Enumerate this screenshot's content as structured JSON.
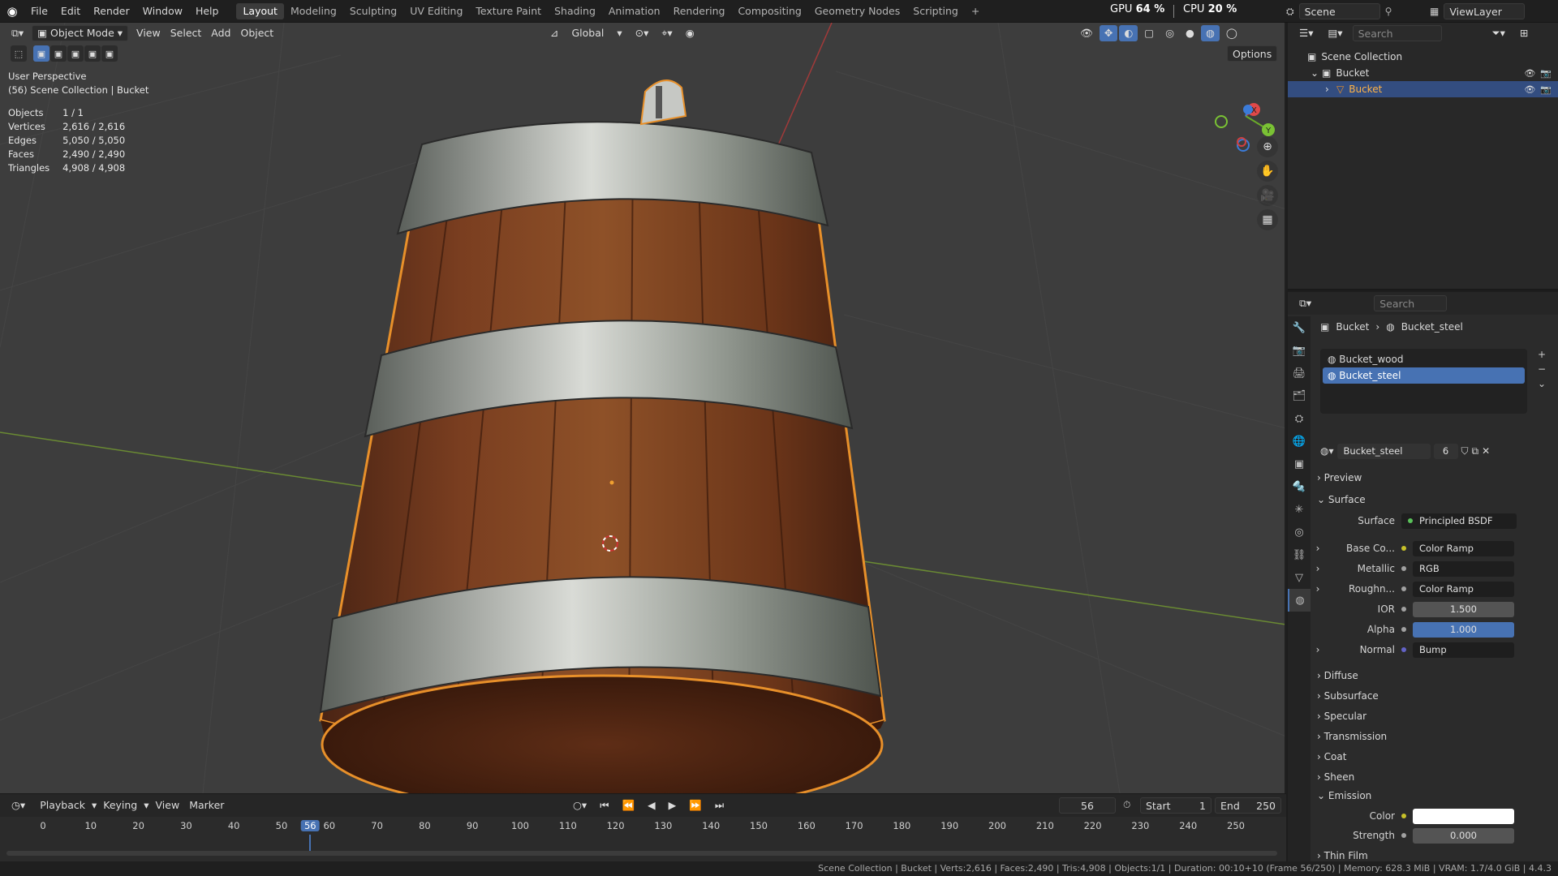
{
  "topbar": {
    "menus": [
      "File",
      "Edit",
      "Render",
      "Window",
      "Help"
    ],
    "workspaces": [
      "Layout",
      "Modeling",
      "Sculpting",
      "UV Editing",
      "Texture Paint",
      "Shading",
      "Animation",
      "Rendering",
      "Compositing",
      "Geometry Nodes",
      "Scripting"
    ],
    "active_workspace": "Layout",
    "add_tab": "+",
    "gpu_label": "GPU",
    "gpu_value": "64 %",
    "cpu_label": "CPU",
    "cpu_value": "20 %",
    "scene": "Scene",
    "view_layer": "ViewLayer"
  },
  "viewport": {
    "mode": "Object Mode",
    "menus": [
      "View",
      "Select",
      "Add",
      "Object"
    ],
    "orientation": "Global",
    "options": "Options",
    "perspective": "User Perspective",
    "collection": "(56) Scene Collection | Bucket",
    "stats": [
      {
        "label": "Objects",
        "value": "1 / 1"
      },
      {
        "label": "Vertices",
        "value": "2,616 / 2,616"
      },
      {
        "label": "Edges",
        "value": "5,050 / 5,050"
      },
      {
        "label": "Faces",
        "value": "2,490 / 2,490"
      },
      {
        "label": "Triangles",
        "value": "4,908 / 4,908"
      }
    ],
    "gizmo": {
      "x": "X",
      "y": "Y",
      "z": "Z"
    }
  },
  "timeline": {
    "menus": [
      "Playback",
      "Keying",
      "View",
      "Marker"
    ],
    "current_frame": "56",
    "start_label": "Start",
    "start": "1",
    "end_label": "End",
    "end": "250",
    "ticks": [
      "0",
      "10",
      "20",
      "30",
      "40",
      "50",
      "56",
      "60",
      "70",
      "80",
      "90",
      "100",
      "110",
      "120",
      "130",
      "140",
      "150",
      "160",
      "170",
      "180",
      "190",
      "200",
      "210",
      "220",
      "230",
      "240",
      "250"
    ]
  },
  "statusbar": "Scene Collection | Bucket | Verts:2,616 | Faces:2,490 | Tris:4,908 | Objects:1/1 | Duration: 00:10+10 (Frame 56/250) | Memory: 628.3 MiB | VRAM: 1.7/4.0 GiB | 4.4.3",
  "outliner": {
    "search_placeholder": "Search",
    "rows": [
      {
        "label": "Scene Collection",
        "indent": 0
      },
      {
        "label": "Bucket",
        "indent": 1
      },
      {
        "label": "Bucket",
        "indent": 2,
        "selected": true
      }
    ]
  },
  "properties": {
    "search_placeholder": "Search",
    "breadcrumb_object": "Bucket",
    "breadcrumb_material": "Bucket_steel",
    "slots": [
      {
        "name": "Bucket_wood",
        "selected": false
      },
      {
        "name": "Bucket_steel",
        "selected": true
      }
    ],
    "material_name": "Bucket_steel",
    "user_count": "6",
    "preview": "Preview",
    "surface_section": "Surface",
    "surface_label": "Surface",
    "surface_value": "Principled BSDF",
    "fields": [
      {
        "label": "Base Co...",
        "value": "Color Ramp",
        "dot": "#c7c129",
        "expand": true
      },
      {
        "label": "Metallic",
        "value": "RGB",
        "dot": "#a1a1a1",
        "expand": true
      },
      {
        "label": "Roughn...",
        "value": "Color Ramp",
        "dot": "#a1a1a1",
        "expand": true
      },
      {
        "label": "IOR",
        "value": "1.500",
        "dot": "#a1a1a1",
        "num": true
      },
      {
        "label": "Alpha",
        "value": "1.000",
        "dot": "#a1a1a1",
        "num": true,
        "blue": true
      },
      {
        "label": "Normal",
        "value": "Bump",
        "dot": "#6363c7",
        "expand": true
      }
    ],
    "subsections": [
      "Diffuse",
      "Subsurface",
      "Specular",
      "Transmission",
      "Coat",
      "Sheen"
    ],
    "emission_section": "Emission",
    "emission_color_label": "Color",
    "emission_strength_label": "Strength",
    "emission_strength": "0.000",
    "thin_film": "Thin Film"
  }
}
